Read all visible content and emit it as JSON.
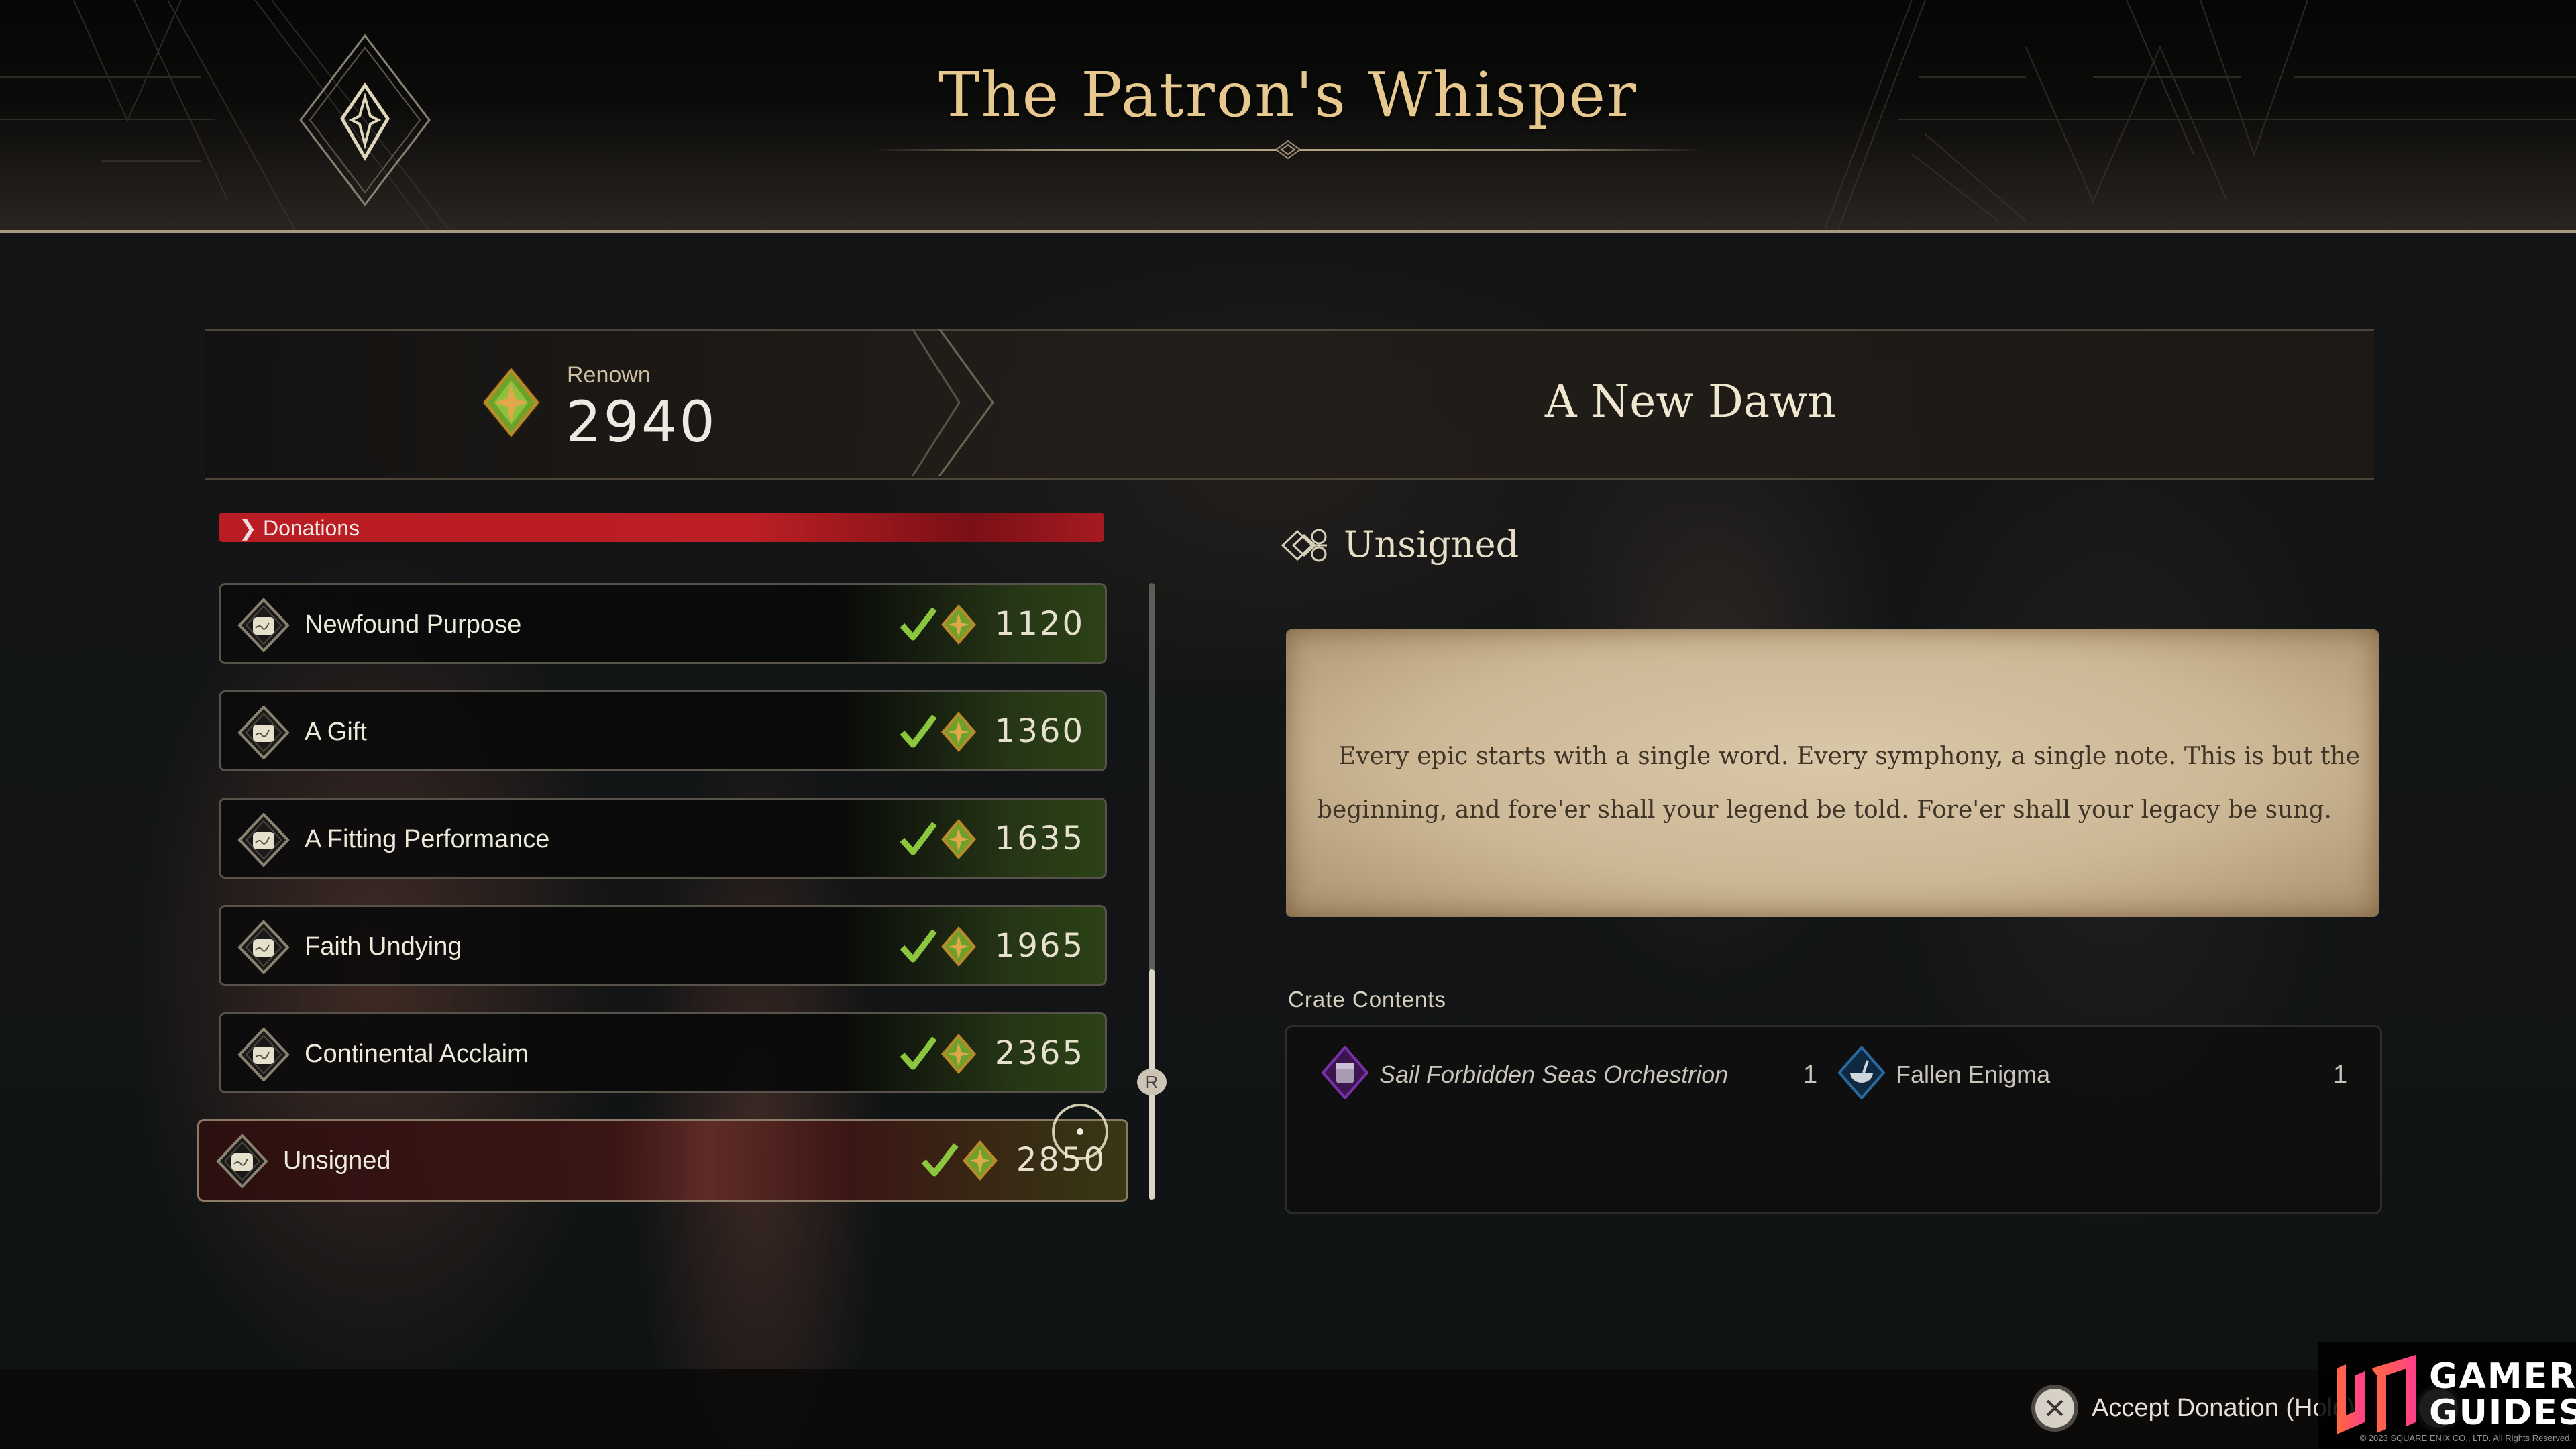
{
  "header": {
    "title": "The Patron's Whisper",
    "emblem_icon": "compass-star-diamond-icon"
  },
  "renown": {
    "label": "Renown",
    "value": "2940",
    "icon": "renown-gem-icon"
  },
  "quest": {
    "title": "A New Dawn"
  },
  "donations": {
    "section_label": "Donations",
    "items": [
      {
        "name": "Newfound Purpose",
        "cost": "1120",
        "completed": true,
        "selected": false
      },
      {
        "name": "A Gift",
        "cost": "1360",
        "completed": true,
        "selected": false
      },
      {
        "name": "A Fitting Performance",
        "cost": "1635",
        "completed": true,
        "selected": false
      },
      {
        "name": "Faith Undying",
        "cost": "1965",
        "completed": true,
        "selected": false
      },
      {
        "name": "Continental Acclaim",
        "cost": "2365",
        "completed": true,
        "selected": false
      },
      {
        "name": "Unsigned",
        "cost": "2850",
        "completed": true,
        "selected": true
      }
    ],
    "scrollbar_knob_label": "R"
  },
  "detail": {
    "heading": "Unsigned",
    "letter_text": "Every epic starts with a single word. Every symphony, a single note. This is but the beginning, and fore'er shall your legend be told. Fore'er shall your legacy be sung.",
    "crate_label": "Crate Contents",
    "crate_items": [
      {
        "name": "Sail Forbidden Seas Orchestrion",
        "qty": "1",
        "icon": "orchestrion-icon",
        "color": "#6a2a8a"
      },
      {
        "name": "Fallen Enigma",
        "qty": "1",
        "icon": "bowl-icon",
        "color": "#1f4e78"
      }
    ]
  },
  "footer": {
    "accept_label": "Accept Donation (Hold)",
    "accept_button_glyph": "cross-button"
  },
  "watermark": {
    "line1": "GAMER",
    "line2": "GUIDES",
    "copyright": "© 2023 SQUARE ENIX CO., LTD. All Rights Reserved."
  },
  "colors": {
    "title_gold": "#e7c98f",
    "donations_red": "#b91c22",
    "check_green": "#8cc63f",
    "parchment": "#d3c09f"
  }
}
